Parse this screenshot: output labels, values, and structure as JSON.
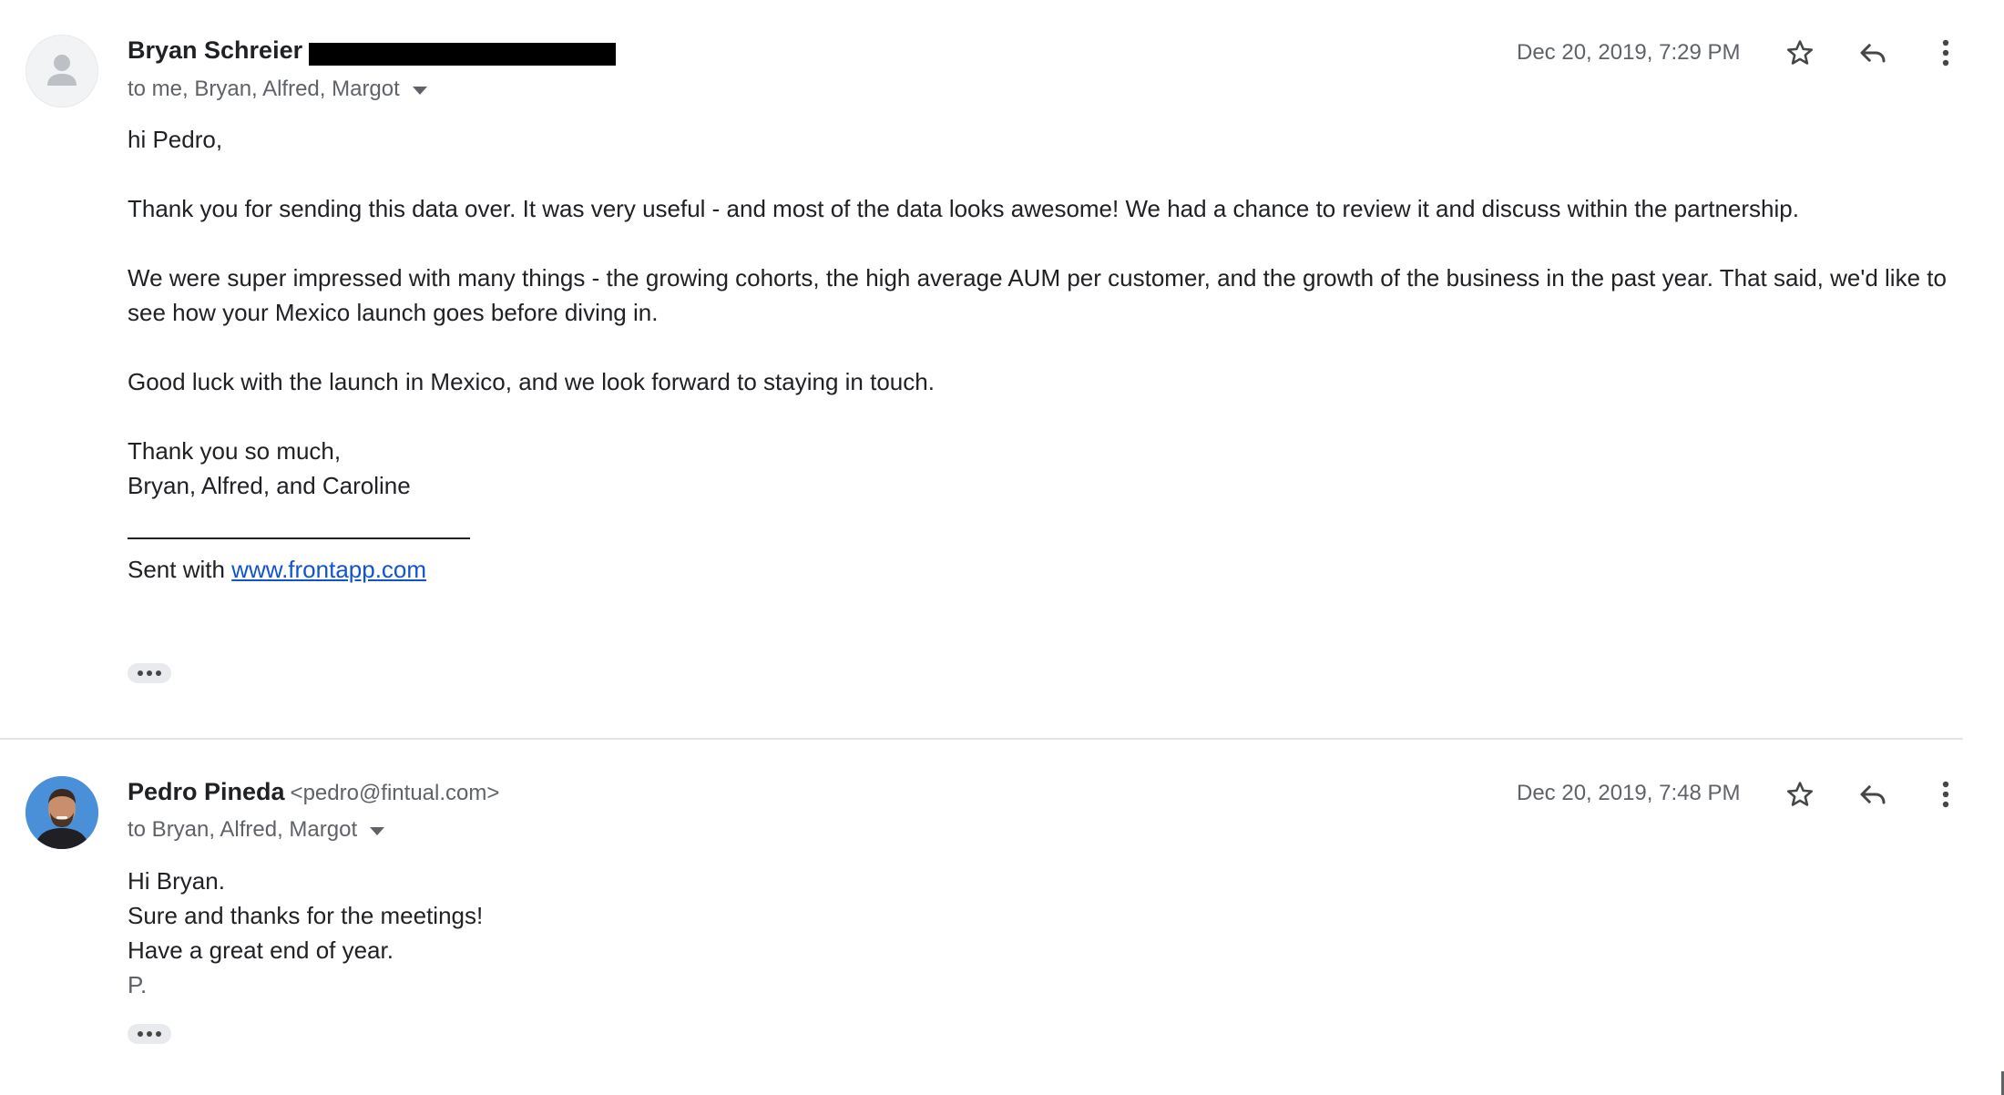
{
  "messages": [
    {
      "sender_name": "Bryan Schreier",
      "recipients": "to me, Bryan, Alfred, Margot",
      "date": "Dec 20, 2019, 7:29 PM",
      "body": {
        "greeting": "hi Pedro,",
        "para1": "Thank you for sending this data over. It was very useful - and most of the data looks awesome! We had a chance to review it and discuss within the partnership.",
        "para2": "We were super impressed with many things - the growing cohorts, the high average AUM per customer, and the growth of the business in the past year. That said, we'd like to see how your Mexico launch goes before diving in.",
        "para3": "Good luck with the launch in Mexico, and we look forward to staying in touch.",
        "closing": "Thank you so much,",
        "signature": "Bryan, Alfred, and Caroline",
        "sent_with_prefix": "Sent with ",
        "sent_with_link": "www.frontapp.com"
      }
    },
    {
      "sender_name": "Pedro Pineda",
      "sender_email": "<pedro@fintual.com>",
      "recipients": "to Bryan, Alfred, Margot",
      "date": "Dec 20, 2019, 7:48 PM",
      "body": {
        "line1": "Hi Bryan.",
        "line2": "Sure and thanks for the meetings!",
        "line3": "Have a great end of year.",
        "line4": "P."
      }
    }
  ],
  "icons": {
    "star": "star-icon",
    "reply": "reply-icon",
    "more": "more-vert-icon",
    "show_trimmed": "ellipsis-icon",
    "expand_recipients": "caret-down-icon",
    "avatar_placeholder": "person-icon"
  },
  "colors": {
    "text_primary": "#202124",
    "text_secondary": "#5f6368",
    "link": "#1155cc",
    "divider": "#e3e4e6",
    "avatar_photo_bg": "#4a90d9"
  }
}
